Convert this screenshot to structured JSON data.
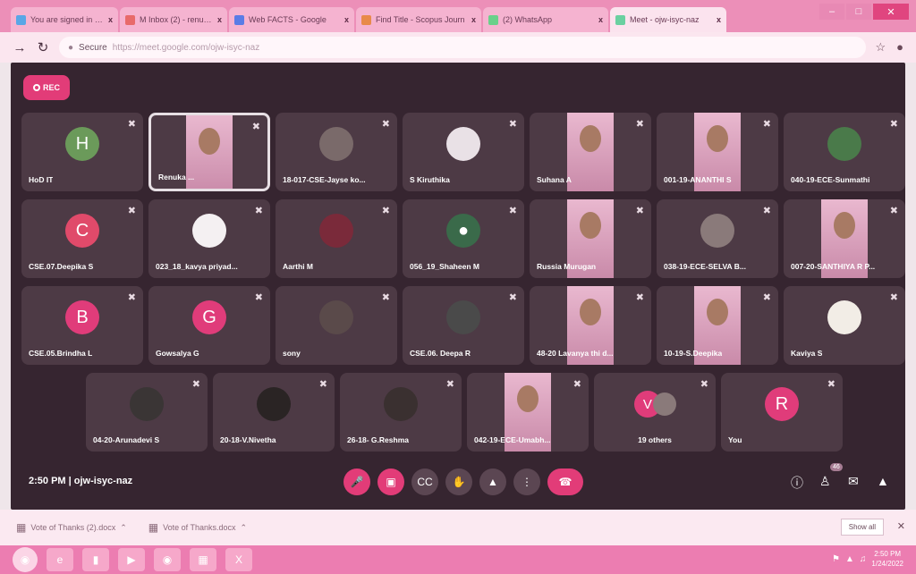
{
  "tabs": [
    {
      "title": "You are signed in as nes",
      "color": "#5aa6e6"
    },
    {
      "title": "M Inbox (2) - renukadevi@ms",
      "color": "#e86a6a"
    },
    {
      "title": "Web FACTS - Google",
      "color": "#5a7ce6"
    },
    {
      "title": "Find Title - Scopus Journ",
      "color": "#e88a4a"
    },
    {
      "title": "(2) WhatsApp",
      "color": "#6ad08a"
    },
    {
      "title": "Meet - ojw-isyc-naz",
      "color": "#6ad0a0",
      "active": true
    }
  ],
  "address": {
    "secure_label": "Secure",
    "url": "https://meet.google.com/ojw-isyc-naz"
  },
  "rec_label": "REC",
  "tiles": [
    {
      "name": "HoD IT",
      "avatar": "H",
      "color": "#6b9a5a",
      "kind": "letter"
    },
    {
      "name": "Renuka ...",
      "kind": "video",
      "highlight": true
    },
    {
      "name": "18-017-CSE-Jayse ko...",
      "kind": "photo",
      "color": "#7a6a6a"
    },
    {
      "name": "S Kiruthika",
      "kind": "photo",
      "color": "#e9e1e6"
    },
    {
      "name": "Suhana A",
      "kind": "video"
    },
    {
      "name": "001-19-ANANTHI S",
      "kind": "video"
    },
    {
      "name": "040-19-ECE-Sunmathi",
      "kind": "photo",
      "color": "#4a7a4a"
    },
    {
      "name": "CSE.07.Deepika S",
      "avatar": "C",
      "color": "#e04a6a",
      "kind": "letter"
    },
    {
      "name": "023_18_kavya priyad...",
      "kind": "photo",
      "color": "#f4f0f2"
    },
    {
      "name": "Aarthi M",
      "kind": "photo",
      "color": "#7a2a3a"
    },
    {
      "name": "056_19_Shaheen M",
      "kind": "person",
      "color": "#3a6a4a"
    },
    {
      "name": "Russia Murugan",
      "kind": "video"
    },
    {
      "name": "038-19-ECE-SELVA B...",
      "kind": "photo",
      "color": "#8a7a7a"
    },
    {
      "name": "007-20-SANTHIYA R P...",
      "kind": "video"
    },
    {
      "name": "CSE.05.Brindha L",
      "avatar": "B",
      "color": "#e03c7a",
      "kind": "letter"
    },
    {
      "name": "Gowsalya G",
      "avatar": "G",
      "color": "#e03c7a",
      "kind": "letter"
    },
    {
      "name": "sony",
      "kind": "photo",
      "color": "#5a4a4a"
    },
    {
      "name": "CSE.06. Deepa R",
      "kind": "photo",
      "color": "#4a4a4a"
    },
    {
      "name": "48-20 Lavanya thi d...",
      "kind": "video"
    },
    {
      "name": "10-19-S.Deepika",
      "kind": "video"
    },
    {
      "name": "Kaviya S",
      "kind": "photo",
      "color": "#f2ede6"
    },
    {
      "name": "04-20-Arunadevi S",
      "kind": "photo",
      "color": "#3a3535"
    },
    {
      "name": "20-18-V.Nivetha",
      "kind": "photo",
      "color": "#2a2424"
    },
    {
      "name": "26-18- G.Reshma",
      "kind": "photo",
      "color": "#3a3030"
    },
    {
      "name": "042-19-ECE-Umabh...",
      "kind": "video"
    },
    {
      "name": "19 others",
      "avatar": "V",
      "color": "#e03c7a",
      "kind": "others"
    },
    {
      "name": "You",
      "avatar": "R",
      "color": "#e03c7a",
      "kind": "letter"
    }
  ],
  "controls": {
    "time_code": "2:50 PM  |  ojw-isyc-naz",
    "participants_count": "46"
  },
  "shelf": {
    "items": [
      {
        "label": "Vote of Thanks (2).docx",
        "icon": "word-doc-icon"
      },
      {
        "label": "Vote of Thanks.docx",
        "icon": "word-doc-icon"
      }
    ],
    "show_all": "Show all"
  },
  "taskbar": {
    "time": "2:50 PM",
    "date": "1/24/2022"
  }
}
